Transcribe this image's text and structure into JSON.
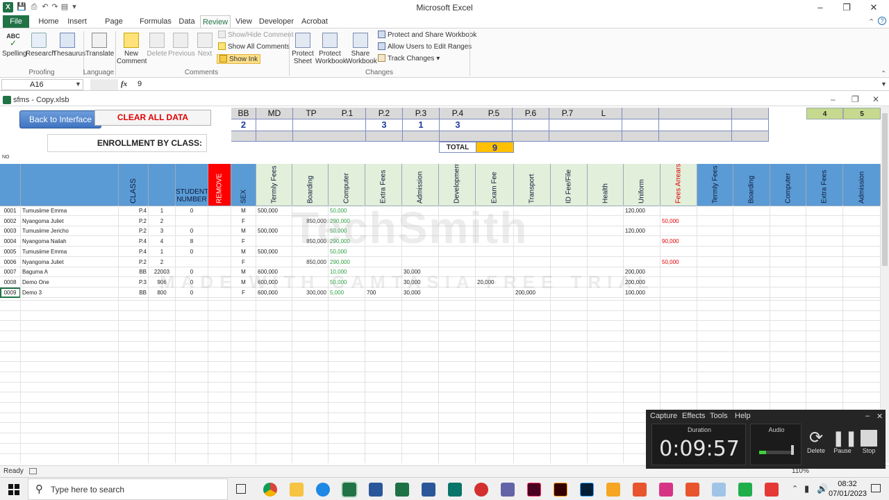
{
  "app": {
    "title": "Microsoft Excel",
    "colors": {
      "excel_green": "#217346",
      "header_blue": "#5b9bd5",
      "remove_red": "#ff0000",
      "total_yellow": "#ffc000"
    }
  },
  "ribbon": {
    "tabs": [
      "File",
      "Home",
      "Insert",
      "Page Layout",
      "Formulas",
      "Data",
      "Review",
      "View",
      "Developer",
      "Acrobat"
    ],
    "active_tab": "Review",
    "proofing": {
      "spelling": "Spelling",
      "research": "Research",
      "thesaurus": "Thesaurus",
      "group": "Proofing"
    },
    "language": {
      "translate": "Translate",
      "group": "Language"
    },
    "comments": {
      "new_comment": "New Comment",
      "delete": "Delete",
      "previous": "Previous",
      "next": "Next",
      "show_hide": "Show/Hide Comment",
      "show_all": "Show All Comments",
      "show_ink": "Show Ink",
      "group": "Comments"
    },
    "changes": {
      "protect_sheet": "Protect Sheet",
      "protect_workbook": "Protect Workbook",
      "share_workbook": "Share Workbook",
      "protect_share": "Protect and Share Workbook",
      "allow_users": "Allow Users to Edit Ranges",
      "track_changes": "Track Changes",
      "group": "Changes"
    }
  },
  "formula_bar": {
    "name_box": "A16",
    "fx": "fx",
    "value": "9"
  },
  "document": {
    "filename": "sfms - Copy.xlsb"
  },
  "sheet": {
    "back_button": "Back to Interface",
    "clear_button": "CLEAR ALL DATA",
    "enrollment_label": "ENROLLMENT BY CLASS:",
    "no_label": "NO",
    "classes": [
      "BB",
      "MD",
      "TP",
      "P.1",
      "P.2",
      "P.3",
      "P.4",
      "P.5",
      "P.6",
      "P.7",
      "L",
      "",
      "",
      "",
      ""
    ],
    "enroll_counts": [
      "2",
      "",
      "",
      "",
      "3",
      "1",
      "3",
      "",
      "",
      "",
      "",
      "",
      "",
      "",
      ""
    ],
    "total_label": "TOTAL",
    "total_value": "9",
    "right_header": [
      "4",
      "5"
    ],
    "columns": [
      "CLASS",
      "STUDENT NUMBER",
      "REMOVE",
      "SEX",
      "Termly Fees",
      "Boarding",
      "Computer",
      "Extra Fees",
      "Admission",
      "Development",
      "Exam Fee",
      "Transport",
      "ID Fee/File",
      "Health",
      "Uniform",
      "Fees Arrears",
      "Termly Fees",
      "Boarding",
      "Computer",
      "Extra Fees",
      "Admission"
    ],
    "rows": [
      {
        "no": "0001",
        "name": "Tumusiime Emma",
        "class": "P.4",
        "num": "1",
        "stu": "0",
        "sex": "M",
        "termly": "500,000",
        "boarding": "",
        "computer": "50,000",
        "extra": "",
        "admission": "",
        "exam": "",
        "transport": "",
        "uniform": "120,000",
        "arrears": ""
      },
      {
        "no": "0002",
        "name": "Nyangoma Juliet",
        "class": "P.2",
        "num": "2",
        "stu": "",
        "sex": "F",
        "termly": "",
        "boarding": "850,000",
        "computer": "290,000",
        "extra": "",
        "admission": "",
        "exam": "",
        "transport": "",
        "uniform": "",
        "arrears": "50,000"
      },
      {
        "no": "0003",
        "name": "Tumusiime Jericho",
        "class": "P.2",
        "num": "3",
        "stu": "0",
        "sex": "M",
        "termly": "500,000",
        "boarding": "",
        "computer": "50,000",
        "extra": "",
        "admission": "",
        "exam": "",
        "transport": "",
        "uniform": "120,000",
        "arrears": ""
      },
      {
        "no": "0004",
        "name": "Nyangoma Nailah",
        "class": "P.4",
        "num": "4",
        "stu": "8",
        "sex": "F",
        "termly": "",
        "boarding": "850,000",
        "computer": "290,000",
        "extra": "",
        "admission": "",
        "exam": "",
        "transport": "",
        "uniform": "",
        "arrears": "90,000"
      },
      {
        "no": "0005",
        "name": "Tumusiime Emma",
        "class": "P.4",
        "num": "1",
        "stu": "0",
        "sex": "M",
        "termly": "500,000",
        "boarding": "",
        "computer": "50,000",
        "extra": "",
        "admission": "",
        "exam": "",
        "transport": "",
        "uniform": "",
        "arrears": ""
      },
      {
        "no": "0006",
        "name": "Nyangoma Juliet",
        "class": "P.2",
        "num": "2",
        "stu": "",
        "sex": "F",
        "termly": "",
        "boarding": "850,000",
        "computer": "290,000",
        "extra": "",
        "admission": "",
        "exam": "",
        "transport": "",
        "uniform": "",
        "arrears": "50,000"
      },
      {
        "no": "0007",
        "name": "Baguma A",
        "class": "BB",
        "num": "22003",
        "stu": "0",
        "sex": "M",
        "termly": "600,000",
        "boarding": "",
        "computer": "10,000",
        "extra": "",
        "admission": "30,000",
        "exam": "",
        "transport": "",
        "uniform": "200,000",
        "arrears": ""
      },
      {
        "no": "0008",
        "name": "Demo One",
        "class": "P.3",
        "num": "906",
        "stu": "0",
        "sex": "M",
        "termly": "600,000",
        "boarding": "",
        "computer": "50,000",
        "extra": "",
        "admission": "30,000",
        "exam": "20,000",
        "transport": "",
        "uniform": "200,000",
        "arrears": ""
      },
      {
        "no": "0009",
        "name": "Demo 3",
        "class": "BB",
        "num": "800",
        "stu": "0",
        "sex": "F",
        "termly": "600,000",
        "boarding": "300,000",
        "computer": "5,000",
        "extra": "700",
        "admission": "30,000",
        "exam": "",
        "transport": "200,000",
        "uniform": "100,000",
        "arrears": ""
      }
    ]
  },
  "watermark": {
    "line1": "TechSmith",
    "line2": "MADE WITH CAMTASIA FREE TRIAL"
  },
  "recorder": {
    "menu": [
      "Capture",
      "Effects",
      "Tools",
      "Help"
    ],
    "duration_label": "Duration",
    "duration": "0:09:57",
    "audio_label": "Audio",
    "delete": "Delete",
    "pause": "Pause",
    "stop": "Stop"
  },
  "status": {
    "ready": "Ready",
    "zoom": "110%"
  },
  "taskbar": {
    "search_placeholder": "Type here to search",
    "time": "08:32",
    "date": "07/01/2023"
  }
}
